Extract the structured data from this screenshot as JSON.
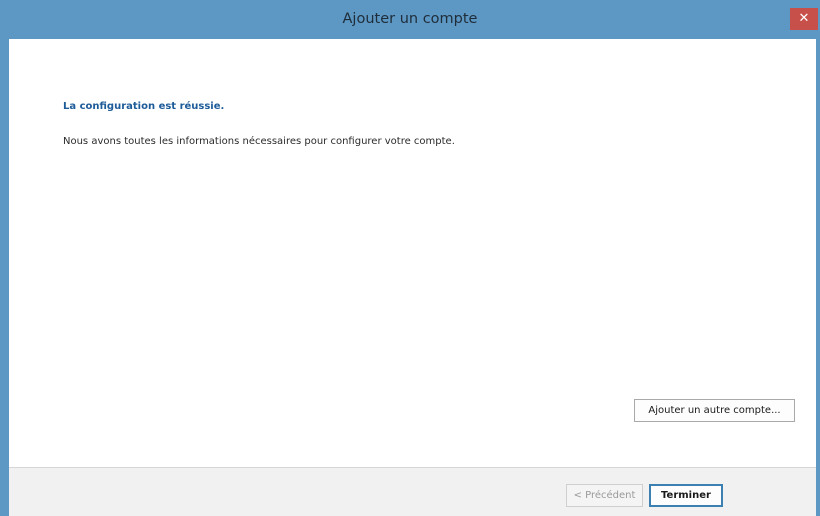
{
  "window": {
    "title": "Ajouter un compte",
    "close_glyph": "✕"
  },
  "main": {
    "heading": "La configuration est réussie.",
    "message": "Nous avons toutes les informations nécessaires pour configurer votre compte.",
    "add_account_label": "Ajouter un autre compte..."
  },
  "footer": {
    "prev_label": "< Précédent",
    "finish_label": "Terminer"
  },
  "colors": {
    "titlebar": "#5d97c3",
    "close_button": "#c7504a",
    "heading": "#1d5b99",
    "default_button_border": "#3c7fb1"
  }
}
